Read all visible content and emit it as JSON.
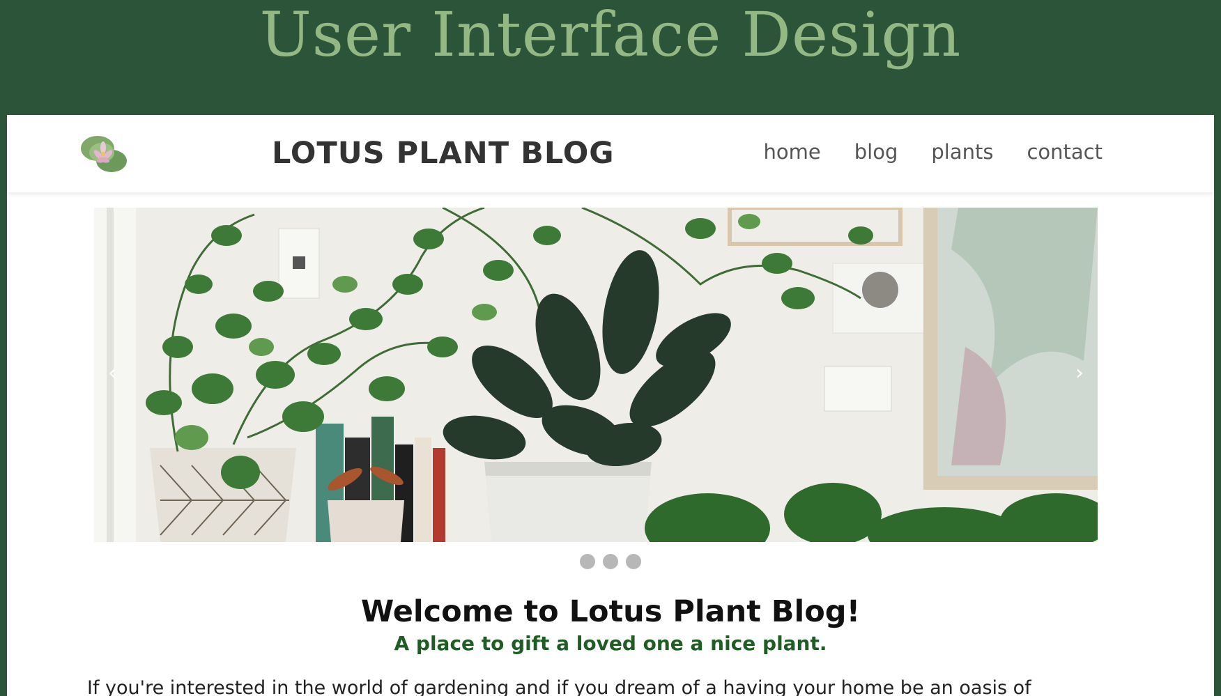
{
  "slide": {
    "title": "User Interface Design"
  },
  "navbar": {
    "brand": "LOTUS PLANT BLOG",
    "links": [
      "home",
      "blog",
      "plants",
      "contact"
    ]
  },
  "carousel": {
    "prev_arrow": "‹",
    "next_arrow": "›",
    "indicator_count": 3
  },
  "content": {
    "welcome": "Welcome to Lotus Plant Blog!",
    "tagline": "A place to gift a loved one a nice plant.",
    "intro": "If you're interested in the world of gardening and if you dream of a having your home be an oasis of"
  },
  "colors": {
    "frame_green": "#2b5438",
    "title_green": "#93b884",
    "tagline_green": "#1f5d24"
  }
}
